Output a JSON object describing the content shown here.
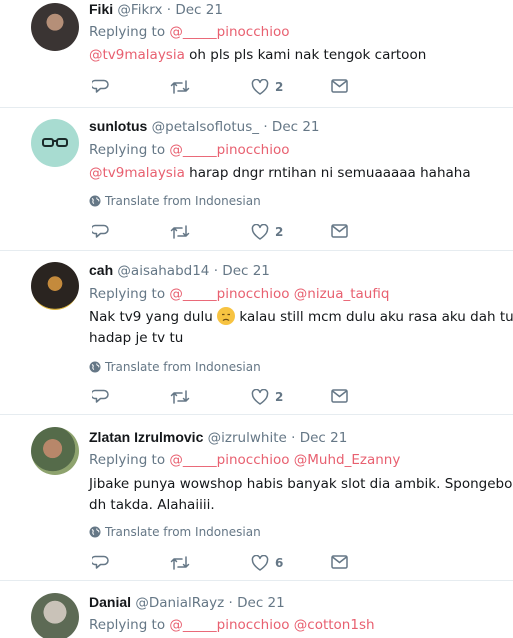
{
  "labels": {
    "replying_to": "Replying to",
    "translate": "Translate from Indonesian"
  },
  "colors": {
    "accent": "#e86070",
    "muted": "#657786",
    "divider": "#e6ecf0"
  },
  "tweets": [
    {
      "name": "Fiki",
      "handle": "@Fikrx",
      "date": "Dec 21",
      "replying": [
        "@_____pinocchioo"
      ],
      "mention": "@tv9malaysia",
      "text": "oh pls pls kami nak tengok cartoon",
      "line2": "",
      "translate": false,
      "likes": "2"
    },
    {
      "name": "sunlotus",
      "handle": "@petalsoflotus_",
      "date": "Dec 21",
      "replying": [
        "@_____pinocchioo"
      ],
      "mention": "@tv9malaysia",
      "text": "harap dngr rntihan ni semuaaaaa hahaha",
      "line2": "",
      "translate": true,
      "likes": "2"
    },
    {
      "name": "cah",
      "handle": "@aisahabd14",
      "date": "Dec 21",
      "replying": [
        "@_____pinocchioo",
        "@nizua_taufiq"
      ],
      "mention": "",
      "text": "Nak tv9 yang dulu",
      "text_after_emoji": "kalau still mcm dulu aku rasa aku dah tua ni pun",
      "emoji": "disappointed-face",
      "line2": "hadap je tv tu",
      "translate": true,
      "likes": "2"
    },
    {
      "name": "Zlatan Izrulmovic",
      "handle": "@izrulwhite",
      "date": "Dec 21",
      "replying": [
        "@_____pinocchioo",
        "@Muhd_Ezanny"
      ],
      "mention": "",
      "text": "Jibake punya wowshop habis banyak slot dia ambik. Spongebob pukul",
      "line2": "dh takda. Alahaiiii.",
      "translate": true,
      "likes": "6"
    },
    {
      "name": "Danial",
      "handle": "@DanialRayz",
      "date": "Dec 21",
      "replying": [
        "@_____pinocchioo",
        "@cotton1sh"
      ],
      "mention": "",
      "text": "",
      "line2": "",
      "translate": false,
      "likes": ""
    }
  ]
}
